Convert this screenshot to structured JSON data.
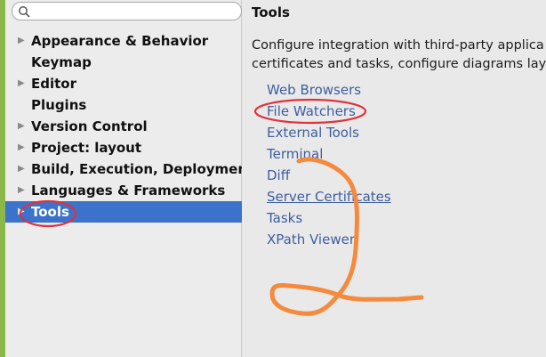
{
  "search": {
    "value": "",
    "placeholder": "",
    "icon": "search-icon"
  },
  "sidebar": {
    "items": [
      {
        "label": "Appearance & Behavior",
        "expandable": true
      },
      {
        "label": "Keymap",
        "expandable": false
      },
      {
        "label": "Editor",
        "expandable": true
      },
      {
        "label": "Plugins",
        "expandable": false
      },
      {
        "label": "Version Control",
        "expandable": true
      },
      {
        "label": "Project: layout",
        "expandable": true
      },
      {
        "label": "Build, Execution, Deployment",
        "expandable": true
      },
      {
        "label": "Languages & Frameworks",
        "expandable": true
      },
      {
        "label": "Tools",
        "expandable": true,
        "selected": true
      }
    ],
    "arrow_glyph": "▶"
  },
  "main": {
    "title": "Tools",
    "description_line1": "Configure integration with third-party applica",
    "description_line2": "certificates and tasks, configure diagrams layo",
    "links": [
      "Web Browsers",
      "File Watchers",
      "External Tools",
      "Terminal",
      "Diff",
      "Server Certificates",
      "Tasks",
      "XPath Viewer"
    ]
  },
  "colors": {
    "selection": "#3b73cc",
    "link": "#3e5ea1",
    "annotation_red": "#e0323c",
    "annotation_orange": "#f58a3c",
    "accent_strip": "#8cb84a"
  }
}
